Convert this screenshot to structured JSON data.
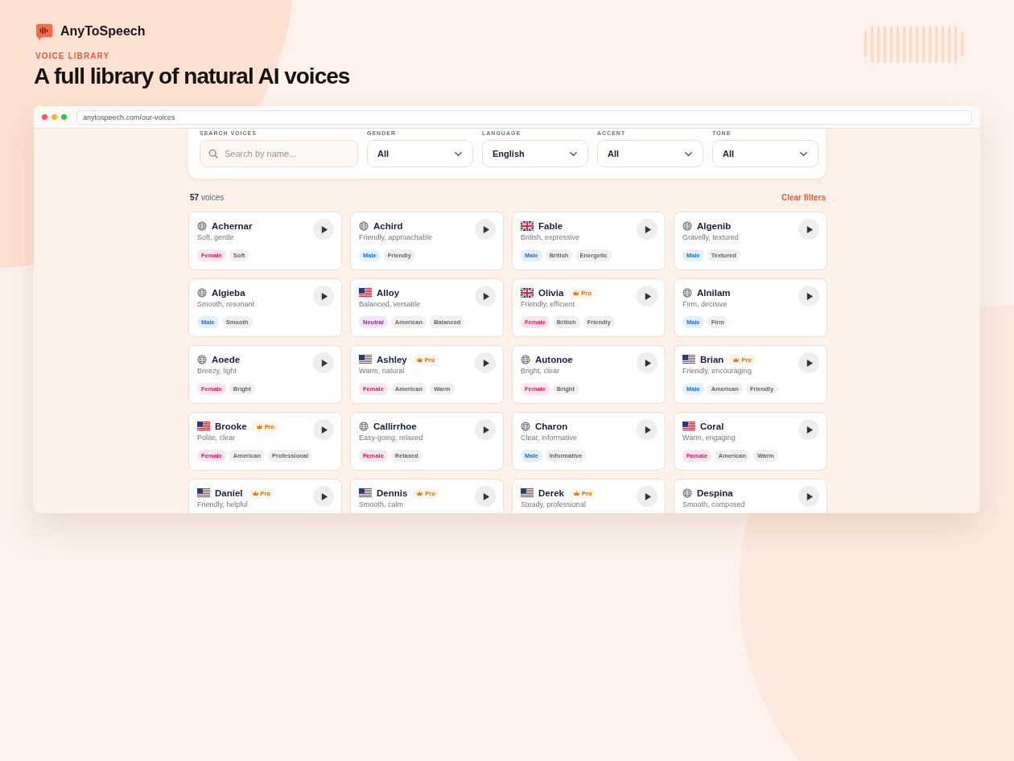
{
  "brand": {
    "name": "AnyToSpeech"
  },
  "eyebrow": "VOICE LIBRARY",
  "headline": "A full library of natural AI voices",
  "browser": {
    "url": "anytospeech.com/our-voices"
  },
  "filters": [
    {
      "kind": "search",
      "label": "SEARCH VOICES",
      "placeholder": "Search by name..."
    },
    {
      "kind": "select",
      "label": "GENDER",
      "value": "All"
    },
    {
      "kind": "select",
      "label": "LANGUAGE",
      "value": "English"
    },
    {
      "kind": "select",
      "label": "ACCENT",
      "value": "All"
    },
    {
      "kind": "select",
      "label": "TONE",
      "value": "All"
    }
  ],
  "results": {
    "count": "57",
    "unit": "voices",
    "clear": "Clear filters"
  },
  "voices": [
    {
      "kind": "globe",
      "name": "Achernar",
      "description": "Soft, gentle",
      "tags": [
        {
          "label": "Female",
          "kind": "female"
        },
        {
          "label": "Soft",
          "kind": "plain"
        }
      ]
    },
    {
      "kind": "globe",
      "name": "Achird",
      "description": "Friendly, approachable",
      "tags": [
        {
          "label": "Male",
          "kind": "male"
        },
        {
          "label": "Friendly",
          "kind": "plain"
        }
      ]
    },
    {
      "kind": "uk",
      "name": "Fable",
      "description": "British, expressive",
      "tags": [
        {
          "label": "Male",
          "kind": "male"
        },
        {
          "label": "British",
          "kind": "plain"
        },
        {
          "label": "Energetic",
          "kind": "plain"
        }
      ]
    },
    {
      "kind": "globe",
      "name": "Algenib",
      "description": "Gravelly, textured",
      "tags": [
        {
          "label": "Male",
          "kind": "male"
        },
        {
          "label": "Textured",
          "kind": "plain"
        }
      ]
    },
    {
      "kind": "globe",
      "name": "Algieba",
      "description": "Smooth, resonant",
      "tags": [
        {
          "label": "Male",
          "kind": "male"
        },
        {
          "label": "Smooth",
          "kind": "plain"
        }
      ]
    },
    {
      "kind": "us",
      "name": "Alloy",
      "description": "Balanced, versatile",
      "tags": [
        {
          "label": "Neutral",
          "kind": "neutral"
        },
        {
          "label": "American",
          "kind": "plain"
        },
        {
          "label": "Balanced",
          "kind": "plain"
        }
      ]
    },
    {
      "kind": "uk",
      "name": "Olivia",
      "badge": "Pro",
      "description": "Friendly, efficient",
      "tags": [
        {
          "label": "Female",
          "kind": "female"
        },
        {
          "label": "British",
          "kind": "plain"
        },
        {
          "label": "Friendly",
          "kind": "plain"
        }
      ]
    },
    {
      "kind": "globe",
      "name": "Alnilam",
      "description": "Firm, decisive",
      "tags": [
        {
          "label": "Male",
          "kind": "male"
        },
        {
          "label": "Firm",
          "kind": "plain"
        }
      ]
    },
    {
      "kind": "globe",
      "name": "Aoede",
      "description": "Breezy, light",
      "tags": [
        {
          "label": "Female",
          "kind": "female"
        },
        {
          "label": "Bright",
          "kind": "plain"
        }
      ]
    },
    {
      "kind": "us",
      "name": "Ashley",
      "badge": "Pro",
      "description": "Warm, natural",
      "tags": [
        {
          "label": "Female",
          "kind": "female"
        },
        {
          "label": "American",
          "kind": "plain"
        },
        {
          "label": "Warm",
          "kind": "plain"
        }
      ]
    },
    {
      "kind": "globe",
      "name": "Autonoe",
      "description": "Bright, clear",
      "tags": [
        {
          "label": "Female",
          "kind": "female"
        },
        {
          "label": "Bright",
          "kind": "plain"
        }
      ]
    },
    {
      "kind": "us",
      "name": "Brian",
      "badge": "Pro",
      "description": "Friendly, encouraging",
      "tags": [
        {
          "label": "Male",
          "kind": "male"
        },
        {
          "label": "American",
          "kind": "plain"
        },
        {
          "label": "Friendly",
          "kind": "plain"
        }
      ]
    },
    {
      "kind": "us",
      "name": "Brooke",
      "badge": "Pro",
      "description": "Polite, clear",
      "tags": [
        {
          "label": "Female",
          "kind": "female"
        },
        {
          "label": "American",
          "kind": "plain"
        },
        {
          "label": "Professional",
          "kind": "plain"
        }
      ]
    },
    {
      "kind": "globe",
      "name": "Callirrhoe",
      "description": "Easy-going, relaxed",
      "tags": [
        {
          "label": "Female",
          "kind": "female"
        },
        {
          "label": "Relaxed",
          "kind": "plain"
        }
      ]
    },
    {
      "kind": "globe",
      "name": "Charon",
      "description": "Clear, informative",
      "tags": [
        {
          "label": "Male",
          "kind": "male"
        },
        {
          "label": "Informative",
          "kind": "plain"
        }
      ]
    },
    {
      "kind": "us",
      "name": "Coral",
      "description": "Warm, engaging",
      "tags": [
        {
          "label": "Female",
          "kind": "female"
        },
        {
          "label": "American",
          "kind": "plain"
        },
        {
          "label": "Warm",
          "kind": "plain"
        }
      ]
    },
    {
      "kind": "us",
      "name": "Daniel",
      "badge": "Pro",
      "description": "Friendly, helpful"
    },
    {
      "kind": "us",
      "name": "Dennis",
      "badge": "Pro",
      "description": "Smooth, calm"
    },
    {
      "kind": "us",
      "name": "Derek",
      "badge": "Pro",
      "description": "Steady, professional"
    },
    {
      "kind": "globe",
      "name": "Despina",
      "description": "Smooth, composed"
    }
  ]
}
